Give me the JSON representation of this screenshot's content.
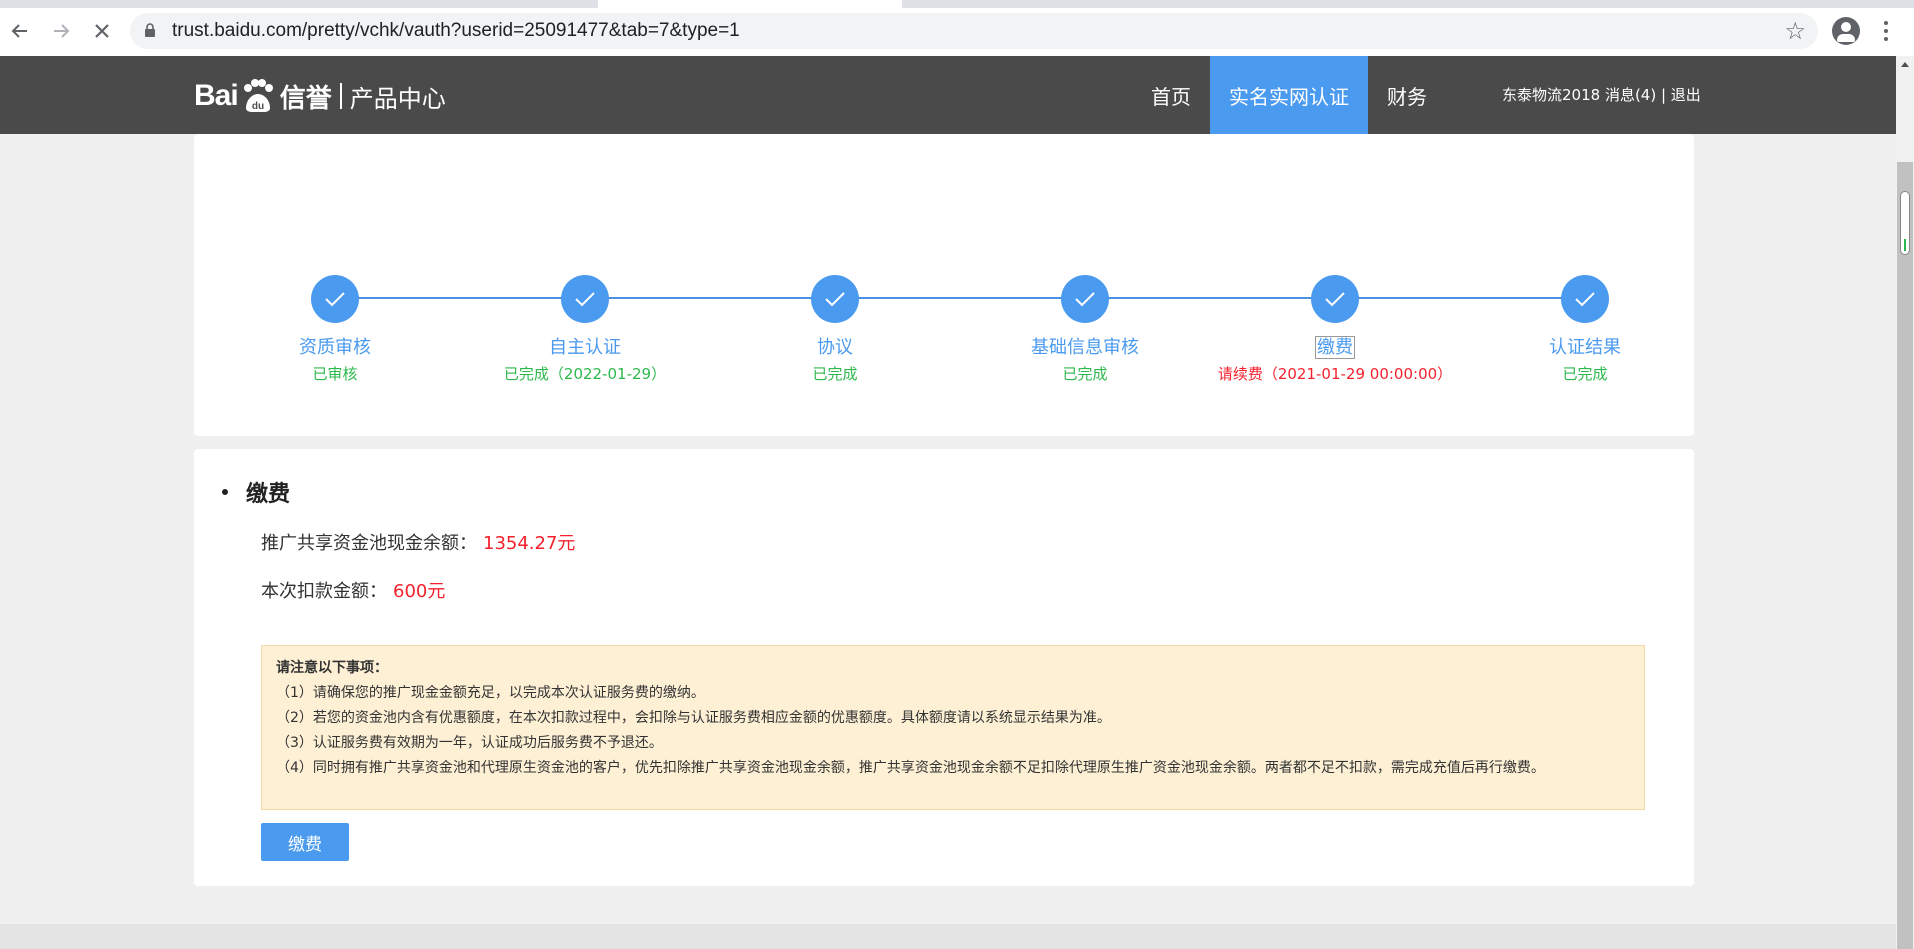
{
  "browser": {
    "url": "trust.baidu.com/pretty/vchk/vauth?userid=25091477&tab=7&type=1"
  },
  "header": {
    "logo_bai": "Bai",
    "logo_du": "du",
    "logo_xinyu": "信誉",
    "logo_center": "产品中心",
    "nav": [
      {
        "label": "首页",
        "active": false
      },
      {
        "label": "实名实网认证",
        "active": true
      },
      {
        "label": "财务",
        "active": false
      }
    ],
    "user_links": "东泰物流2018 消息(4) | 退出"
  },
  "steps": [
    {
      "name": "资质审核",
      "status": "已审核",
      "status_color": "green"
    },
    {
      "name": "自主认证",
      "status": "已完成（2022-01-29）",
      "status_color": "green"
    },
    {
      "name": "协议",
      "status": "已完成",
      "status_color": "green"
    },
    {
      "name": "基础信息审核",
      "status": "已完成",
      "status_color": "green"
    },
    {
      "name": "缴费",
      "status": "请续费（2021-01-29 00:00:00）",
      "status_color": "red"
    },
    {
      "name": "认证结果",
      "status": "已完成",
      "status_color": "green"
    }
  ],
  "payment": {
    "title": "缴费",
    "balance_label": "推广共享资金池现金余额：",
    "balance_value": "1354.27元",
    "deduct_label": "本次扣款金额：",
    "deduct_value": "600元",
    "notice_title": "请注意以下事项：",
    "notice_items": [
      "（1）请确保您的推广现金金额充足，以完成本次认证服务费的缴纳。",
      "（2）若您的资金池内含有优惠额度，在本次扣款过程中，会扣除与认证服务费相应金额的优惠额度。具体额度请以系统显示结果为准。",
      "（3）认证服务费有效期为一年，认证成功后服务费不予退还。",
      "（4）同时拥有推广共享资金池和代理原生资金池的客户，优先扣除推广共享资金池现金余额，推广共享资金池现金余额不足扣除代理原生推广资金池现金余额。两者都不足不扣款，需完成充值后再行缴费。"
    ],
    "pay_button": "缴费"
  },
  "colors": {
    "accent": "#4a9aef",
    "header_bg": "#4a4a4a",
    "success": "#2db84d",
    "danger": "#f5222d",
    "notice_bg": "#fdf0d5"
  }
}
